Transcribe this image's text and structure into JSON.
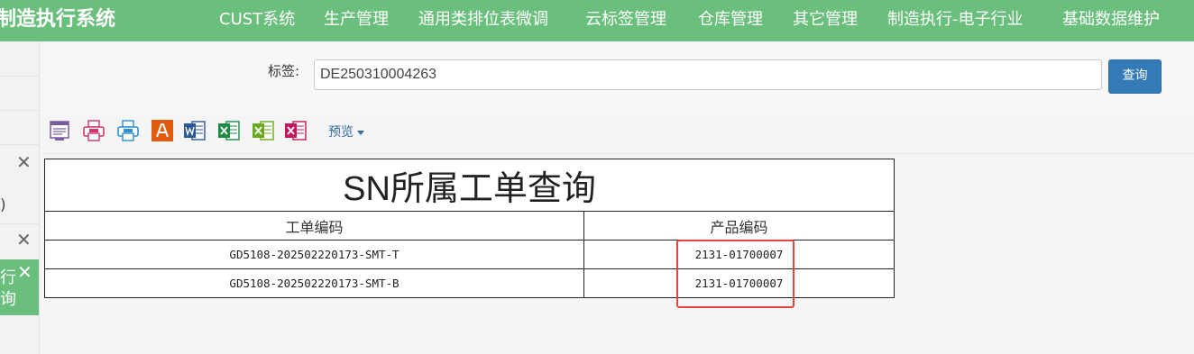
{
  "topbar": {
    "brand": "制造执行系统",
    "menu": [
      "CUST系统",
      "生产管理",
      "通用类排位表微调",
      "云标签管理",
      "仓库管理",
      "其它管理",
      "制造执行-电子行业",
      "基础数据维护"
    ],
    "color": "#6abf7c"
  },
  "sidebar": {
    "partial_text_1": ")",
    "active_tab_text_1": "行",
    "active_tab_text_2": "询",
    "close_glyph": "✕"
  },
  "search": {
    "label": "标签:",
    "value": "DE250310004263",
    "button_label": "查询"
  },
  "toolbar": {
    "icons": [
      "print-preview-icon",
      "pdf-print-icon",
      "pdf-icon",
      "acrobat-icon",
      "word-icon",
      "excel-icon",
      "excel-alt-icon",
      "excel-x-icon"
    ],
    "preview_label": "预览"
  },
  "report": {
    "title": "SN所属工单查询",
    "columns": [
      "工单编码",
      "产品编码"
    ],
    "rows": [
      [
        "GD5108-202502220173-SMT-T",
        "2131-01700007"
      ],
      [
        "GD5108-202502220173-SMT-B",
        "2131-01700007"
      ]
    ]
  },
  "highlight_color": "#e0483e"
}
